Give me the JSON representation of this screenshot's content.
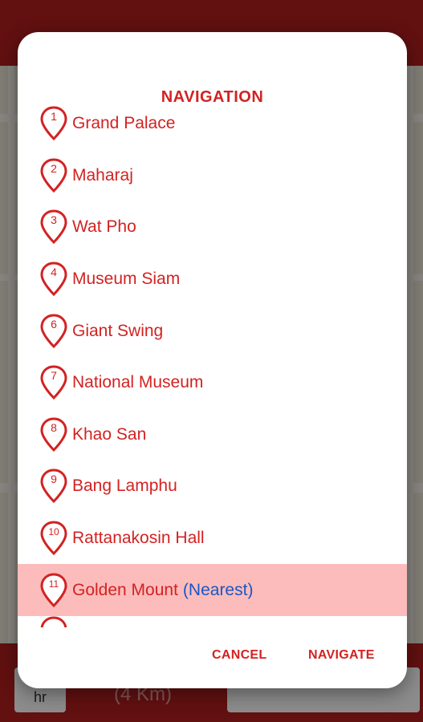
{
  "background": {
    "footer_hr": "hr",
    "footer_km": "(4 Km)"
  },
  "dialog": {
    "title": "NAVIGATION",
    "items": [
      {
        "num": "1",
        "label": "Grand Palace",
        "note": ""
      },
      {
        "num": "2",
        "label": "Maharaj",
        "note": ""
      },
      {
        "num": "3",
        "label": "Wat Pho",
        "note": ""
      },
      {
        "num": "4",
        "label": "Museum Siam",
        "note": ""
      },
      {
        "num": "6",
        "label": "Giant Swing",
        "note": ""
      },
      {
        "num": "7",
        "label": "National Museum",
        "note": ""
      },
      {
        "num": "8",
        "label": "Khao San",
        "note": ""
      },
      {
        "num": "9",
        "label": "Bang Lamphu",
        "note": ""
      },
      {
        "num": "10",
        "label": "Rattanakosin Hall",
        "note": ""
      },
      {
        "num": "11",
        "label": "Golden Mount",
        "note": "(Nearest)",
        "highlighted": true
      }
    ],
    "cancel_label": "CANCEL",
    "navigate_label": "NAVIGATE"
  },
  "colors": {
    "accent": "#d32222",
    "highlight": "#fcbcbc",
    "nearest": "#1a56c4"
  }
}
